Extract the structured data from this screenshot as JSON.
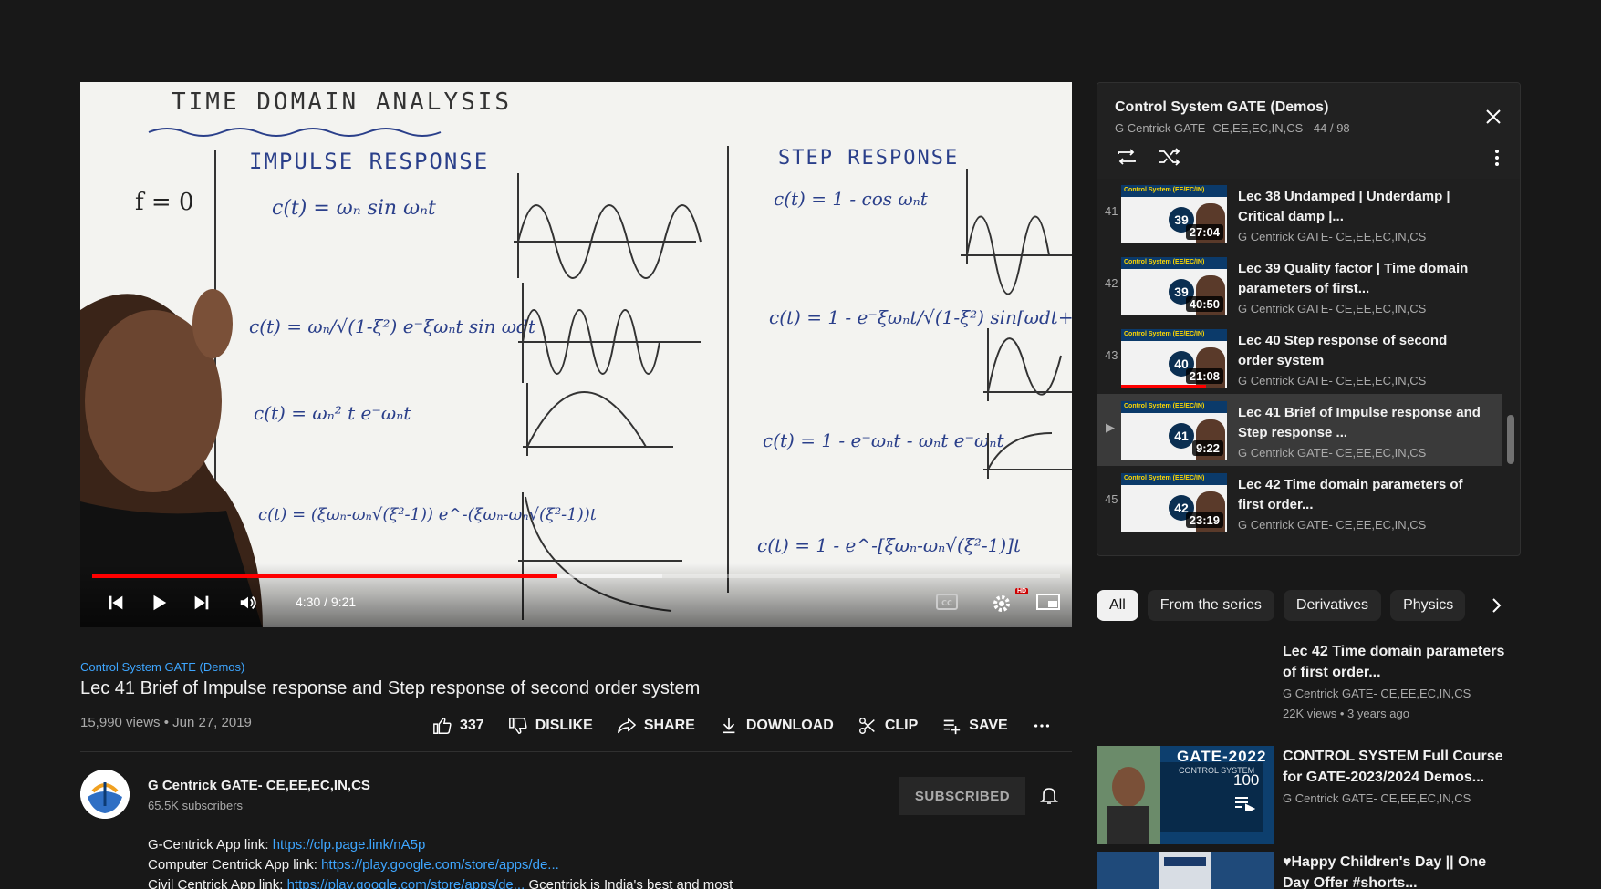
{
  "player": {
    "time": "4:30 / 9:21",
    "played_fraction": 0.481,
    "buffered_fraction": 0.589,
    "hd_badge": "HD"
  },
  "board": {
    "heading": "TIME DOMAIN ANALYSIS",
    "left_col": "IMPULSE RESPONSE",
    "right_col": "STEP RESPONSE"
  },
  "video": {
    "series_link": "Control System GATE (Demos)",
    "title": "Lec 41 Brief of Impulse response and Step response of second order system",
    "views_date": "15,990 views • Jun 27, 2019"
  },
  "actions": {
    "like_count": "337",
    "dislike": "DISLIKE",
    "share": "SHARE",
    "download": "DOWNLOAD",
    "clip": "CLIP",
    "save": "SAVE"
  },
  "channel": {
    "name": "G Centrick GATE- CE,EE,EC,IN,CS",
    "subscribers": "65.5K subscribers",
    "subscribe_button": "SUBSCRIBED"
  },
  "description": {
    "line1_label": "G-Centrick App link: ",
    "line1_link": "https://clp.page.link/nA5p",
    "line2_label": "Computer Centrick App link: ",
    "line2_link": "https://play.google.com/store/apps/de...",
    "line3_label": "Civil Centrick App link: ",
    "line3_link": "https://play.google.com/store/apps/de...",
    "line3_tail": "  Gcentrick is India's best and most"
  },
  "playlist": {
    "title": "Control System GATE (Demos)",
    "subtitle": "G Centrick GATE- CE,EE,EC,IN,CS - 44 / 98",
    "items": [
      {
        "index": "41",
        "title": "Lec 38 Undamped | Underdamp | Critical damp |...",
        "channel": "G Centrick GATE- CE,EE,EC,IN,CS",
        "duration": "27:04",
        "badge": "39",
        "thumb_header": "Control System (EE/EC/IN)"
      },
      {
        "index": "42",
        "title": "Lec 39 Quality factor | Time domain parameters of first...",
        "channel": "G Centrick GATE- CE,EE,EC,IN,CS",
        "duration": "40:50",
        "badge": "39",
        "thumb_header": "Control System (EE/EC/IN)"
      },
      {
        "index": "43",
        "title": "Lec 40 Step response of second order system",
        "channel": "G Centrick GATE- CE,EE,EC,IN,CS",
        "duration": "21:08",
        "badge": "40",
        "thumb_header": "Control System (EE/EC/IN)"
      },
      {
        "index": "▶",
        "title": "Lec 41 Brief of Impulse response and Step response ...",
        "channel": "G Centrick GATE- CE,EE,EC,IN,CS",
        "duration": "9:22",
        "badge": "41",
        "thumb_header": "Control System (EE/EC/IN)"
      },
      {
        "index": "45",
        "title": "Lec 42 Time domain parameters of first order...",
        "channel": "G Centrick GATE- CE,EE,EC,IN,CS",
        "duration": "23:19",
        "badge": "42",
        "thumb_header": "Control System (EE/EC/IN)"
      }
    ]
  },
  "chips": [
    "All",
    "From the series",
    "Derivatives",
    "Physics"
  ],
  "recommendations": [
    {
      "title": "Lec 42 Time domain parameters of first order...",
      "channel": "G Centrick GATE- CE,EE,EC,IN,CS",
      "meta": "22K views  • 3 years ago"
    },
    {
      "title": "CONTROL SYSTEM Full Course for GATE-2023/2024 Demos...",
      "channel": "G Centrick GATE- CE,EE,EC,IN,CS",
      "count": "100",
      "thumb_title": "GATE-2022",
      "thumb_sub": "CONTROL SYSTEM"
    },
    {
      "title": "♥Happy Children's Day || One Day Offer #shorts..."
    }
  ],
  "colors": {
    "background": "#181818",
    "accent_red": "#ff0000",
    "link_blue": "#3ea6ff"
  }
}
